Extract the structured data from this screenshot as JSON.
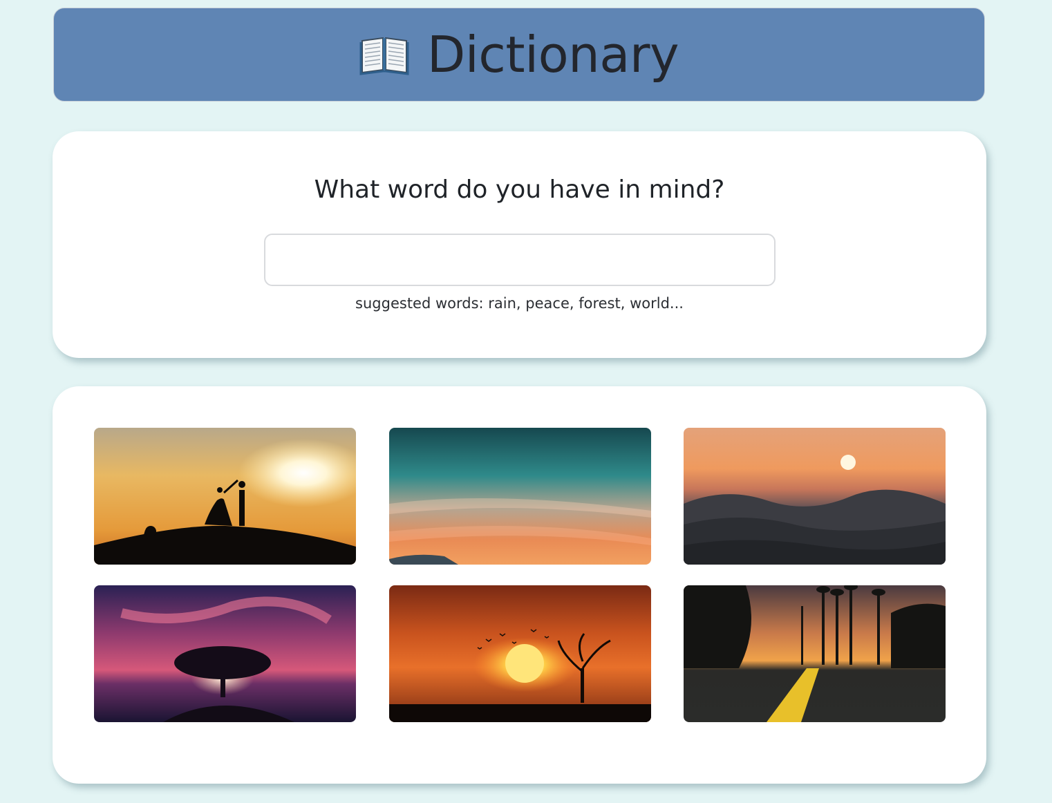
{
  "header": {
    "icon": "open-book-icon",
    "title": "Dictionary",
    "background_color": "#5f85b4"
  },
  "search": {
    "prompt": "What word do you have in mind?",
    "input_value": "",
    "placeholder": "",
    "suggestions": "suggested words: rain, peace, forest, world..."
  },
  "gallery": {
    "photos": [
      {
        "subject": "couple silhouette on hill at sunset"
      },
      {
        "subject": "teal and orange sunset sky"
      },
      {
        "subject": "ocean waves at sunset"
      },
      {
        "subject": "lone tree against purple sky by the sea"
      },
      {
        "subject": "orange sun with birds and bare tree"
      },
      {
        "subject": "road with yellow line and palm trees at dusk"
      }
    ]
  }
}
